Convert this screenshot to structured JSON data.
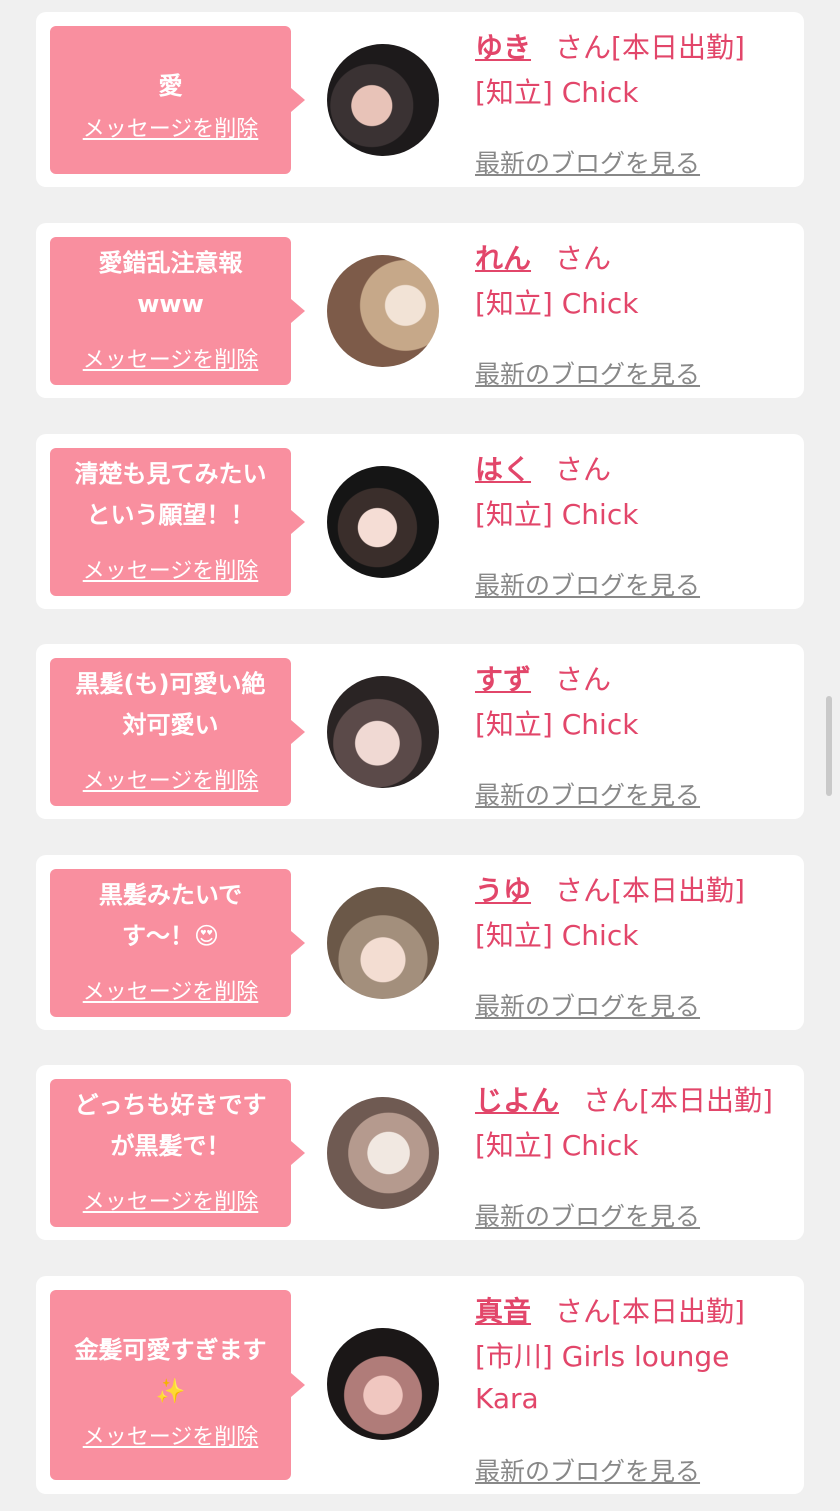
{
  "delete_label": "メッセージを削除",
  "blog_label": "最新のブログを見る",
  "san_suffix": "さん",
  "colors": {
    "accent": "#e2466a",
    "bubble": "#f98f9f",
    "background": "#f0f0f0",
    "muted": "#888888"
  },
  "cards": [
    {
      "message": "愛",
      "name": "ゆき",
      "status": "[本日出勤]",
      "shop": "[知立] Chick"
    },
    {
      "message": "愛錯乱注意報\nwww",
      "name": "れん",
      "status": "",
      "shop": "[知立] Chick"
    },
    {
      "message": "清楚も見てみたい\nという願望！！",
      "name": "はく",
      "status": "",
      "shop": "[知立] Chick"
    },
    {
      "message": "黒髪(も)可愛い絶\n対可愛い",
      "name": "すず",
      "status": "",
      "shop": "[知立] Chick"
    },
    {
      "message": "黒髪みたいで\nす〜！😍",
      "name": "うゆ",
      "status": "[本日出勤]",
      "shop": "[知立] Chick"
    },
    {
      "message": "どっちも好きです\nが黒髪で！",
      "name": "じよん",
      "status": "[本日出勤]",
      "shop": "[知立] Chick"
    },
    {
      "message": "金髪可愛すぎます\n✨",
      "name": "真音",
      "status": "[本日出勤]",
      "shop": "[市川] Girls lounge Kara"
    }
  ]
}
